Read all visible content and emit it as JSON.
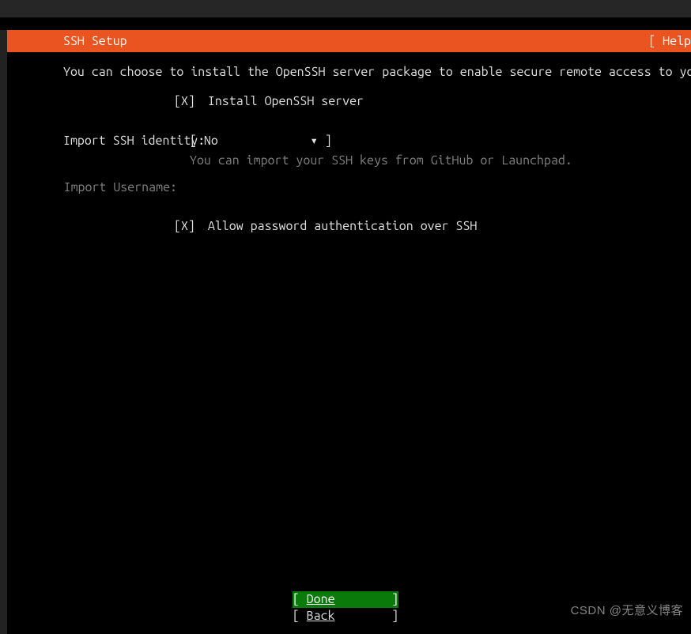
{
  "header": {
    "title": "SSH Setup",
    "help": "[ Help"
  },
  "intro": "You can choose to install the OpenSSH server package to enable secure remote access to your server.",
  "install_openssh": {
    "mark": "[X]",
    "label": "Install OpenSSH server"
  },
  "import_identity": {
    "label": "Import SSH identity:",
    "value": "No",
    "bracket_open": "[ ",
    "bracket_close": " ]",
    "arrow": "▾",
    "hint": "You can import your SSH keys from GitHub or Launchpad."
  },
  "import_username": {
    "label": "Import Username:",
    "value": ""
  },
  "allow_password": {
    "mark": "[X]",
    "label": "Allow password authentication over SSH"
  },
  "actions": {
    "done": "Done",
    "back": "Back"
  },
  "watermark": "CSDN @无意义博客"
}
